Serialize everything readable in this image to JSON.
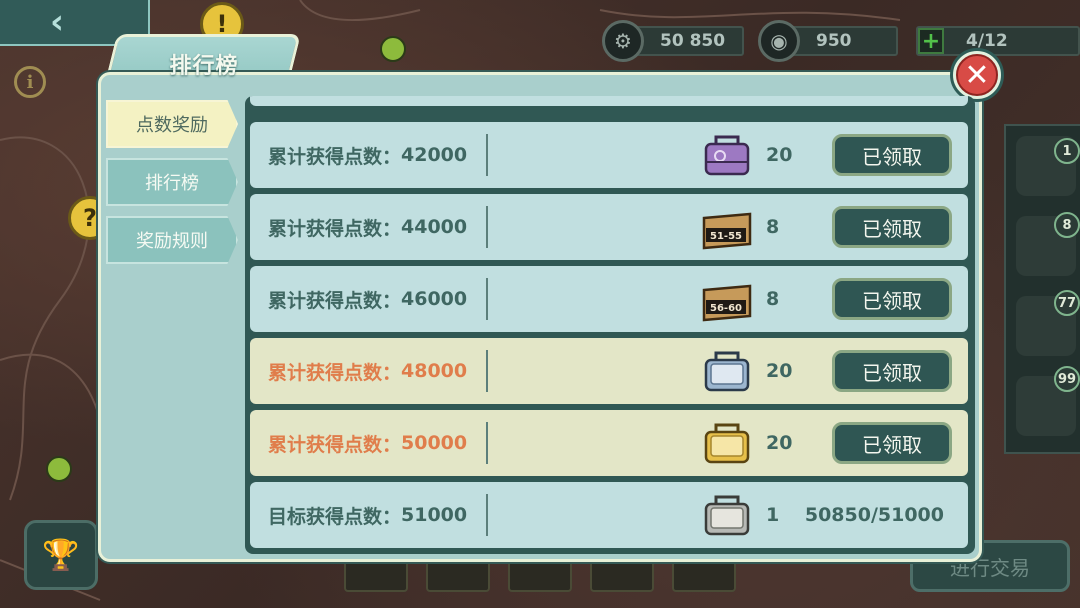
{
  "hud": {
    "back_icon": "chevron-left-icon",
    "caps_value": "50 850",
    "caps_icon": "gear-icon",
    "quantum_value": "950",
    "quantum_icon": "coin-icon",
    "slots_value": "4/12"
  },
  "panel": {
    "title": "排行榜",
    "close_icon": "close-icon"
  },
  "tabs": [
    {
      "label": "点数奖励",
      "active": true
    },
    {
      "label": "排行榜",
      "active": false
    },
    {
      "label": "奖励规则",
      "active": false
    }
  ],
  "rows": [
    {
      "label": "累计获得点数：",
      "points": "42000",
      "reward_icon": "purple-lunchbox-icon",
      "qty": "20",
      "button": "已领取",
      "highlight": false
    },
    {
      "label": "累计获得点数：",
      "points": "44000",
      "reward_icon": "crate-51-55-icon",
      "crate_text": "51-55",
      "qty": "8",
      "button": "已领取",
      "highlight": false
    },
    {
      "label": "累计获得点数：",
      "points": "46000",
      "reward_icon": "crate-56-60-icon",
      "crate_text": "56-60",
      "qty": "8",
      "button": "已领取",
      "highlight": false
    },
    {
      "label": "累计获得点数：",
      "points": "48000",
      "reward_icon": "blue-lunchbox-icon",
      "qty": "20",
      "button": "已领取",
      "highlight": true
    },
    {
      "label": "累计获得点数：",
      "points": "50000",
      "reward_icon": "gold-lunchbox-icon",
      "qty": "20",
      "button": "已领取",
      "highlight": true
    },
    {
      "label": "目标获得点数：",
      "points": "51000",
      "reward_icon": "silver-lunchbox-icon",
      "qty": "1",
      "progress": "50850/51000",
      "highlight": false
    }
  ],
  "side_inventory": [
    {
      "icon": "rope-icon",
      "count": "1"
    },
    {
      "icon": "first-aid-kit-icon",
      "count": "8"
    },
    {
      "icon": "stimpak-icon",
      "count": "77"
    },
    {
      "icon": "radaway-icon",
      "count": "99"
    }
  ],
  "trade_button": "进行交易",
  "trophy_icon": "trophy-icon",
  "info_icon": "info-icon",
  "colors": {
    "panel": "#a9cfcc",
    "row": "#c1dfe0",
    "row_highlight": "#e3e6c7",
    "highlight_text": "#e07d4b",
    "button": "#2f5653"
  }
}
